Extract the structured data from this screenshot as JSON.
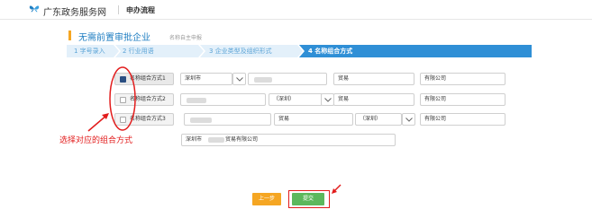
{
  "header": {
    "brand": "广东政务服务网",
    "nav": "申办流程"
  },
  "page": {
    "title": "无需前置审批企业",
    "subtitle": "名称自主申报"
  },
  "steps": [
    {
      "label": "1 字号录入",
      "active": false
    },
    {
      "label": "2 行业用语",
      "active": false
    },
    {
      "label": "3 企业类型及组织形式",
      "active": false
    },
    {
      "label": "4 名称组合方式",
      "active": true
    }
  ],
  "combos": [
    {
      "label": "名称组合方式1",
      "selected": true,
      "region": "深圳市",
      "industry": "贸易",
      "org": "有限公司"
    },
    {
      "label": "名称组合方式2",
      "selected": false,
      "region": "（深圳）",
      "industry": "贸易",
      "org": "有限公司"
    },
    {
      "label": "名称组合方式3",
      "selected": false,
      "industry": "贸易",
      "region": "（深圳）",
      "org": "有限公司"
    }
  ],
  "preview": {
    "prefix": "深圳市",
    "suffix": "贸易有限公司"
  },
  "annotation": {
    "text": "选择对应的组合方式",
    "color": "#e21c1c"
  },
  "buttons": {
    "prev": "上一步",
    "submit": "提交"
  },
  "colors": {
    "accent": "#2f8fd6",
    "title": "#1f7ec2",
    "prev_button": "#f5a623",
    "submit_button": "#5cb85c"
  }
}
